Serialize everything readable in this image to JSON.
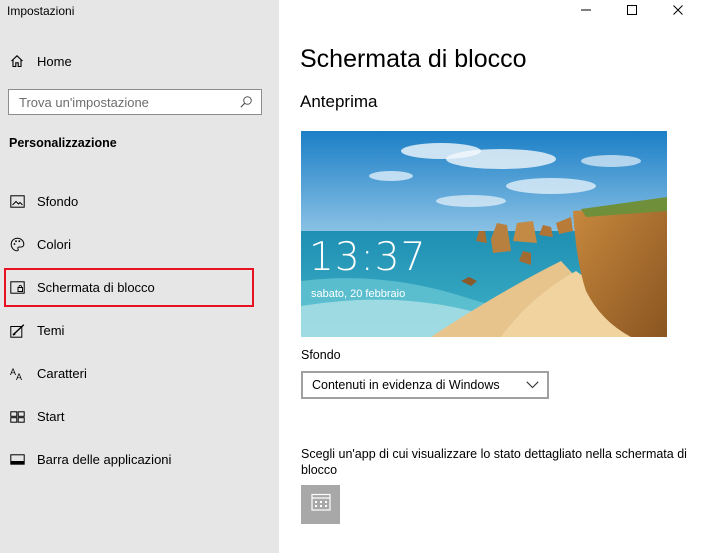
{
  "window": {
    "title": "Impostazioni"
  },
  "sidebar": {
    "home": {
      "label": "Home",
      "icon": "home-icon"
    },
    "search": {
      "placeholder": "Trova un'impostazione",
      "icon": "search-icon"
    },
    "section_title": "Personalizzazione",
    "items": [
      {
        "label": "Sfondo",
        "icon": "picture-icon",
        "selected": false
      },
      {
        "label": "Colori",
        "icon": "palette-icon",
        "selected": false
      },
      {
        "label": "Schermata di blocco",
        "icon": "lock-screen-icon",
        "selected": true
      },
      {
        "label": "Temi",
        "icon": "brush-icon",
        "selected": false
      },
      {
        "label": "Caratteri",
        "icon": "font-icon",
        "selected": false
      },
      {
        "label": "Start",
        "icon": "start-icon",
        "selected": false
      },
      {
        "label": "Barra delle applicazioni",
        "icon": "taskbar-icon",
        "selected": false
      }
    ],
    "highlight_color": "#e81123"
  },
  "main": {
    "title": "Schermata di blocco",
    "preview_heading": "Anteprima",
    "preview": {
      "time": "13:37",
      "date": "sabato, 20 febbraio"
    },
    "background_label": "Sfondo",
    "background_value": "Contenuti in evidenza di Windows",
    "app_description": "Scegli un'app di cui visualizzare lo stato dettagliato nella schermata di blocco",
    "app_tile_icon": "calendar-icon"
  },
  "window_controls": [
    "minimize-icon",
    "maximize-icon",
    "close-icon"
  ]
}
